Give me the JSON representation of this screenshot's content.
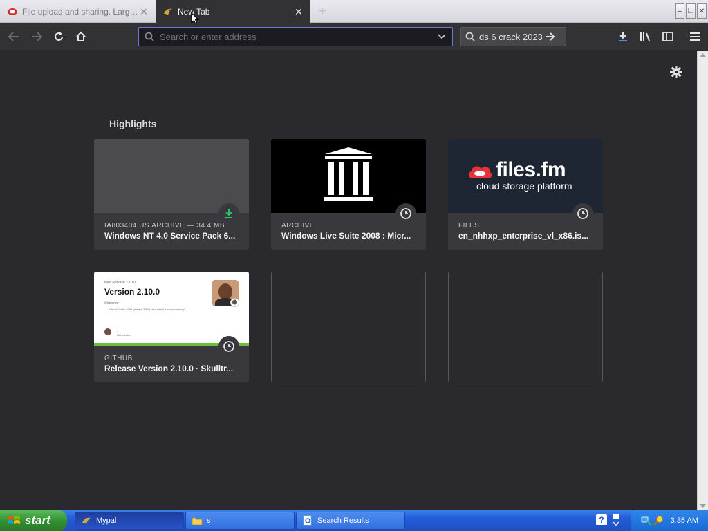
{
  "tabs": [
    {
      "title": "File upload and sharing. Large fil...",
      "active": false
    },
    {
      "title": "New Tab",
      "active": true
    }
  ],
  "navbar": {
    "address_placeholder": "Search or enter address",
    "search_value": "ds 6 crack 2023"
  },
  "main": {
    "section_title": "Highlights",
    "cards": [
      {
        "meta": "IA803404.US.ARCHIVE — 34.4 MB",
        "title": "Windows NT 4.0 Service Pack 6...",
        "badge": "download-icon"
      },
      {
        "meta": "ARCHIVE",
        "title": "Windows Live Suite 2008 : Micr...",
        "badge": "clock-icon"
      },
      {
        "meta": "FILES",
        "title": "en_nhhxp_enterprise_vl_x86.is...",
        "badge": "clock-icon",
        "logo_text": "files.fm",
        "logo_tagline": "cloud storage platform"
      },
      {
        "meta": "GITHUB",
        "title": "Release Version 2.10.0 · Skulltr...",
        "badge": "clock-icon",
        "preview_small": "New Release 2.10.0",
        "preview_heading": "Version 2.10.0",
        "preview_sub": "What's new",
        "preview_bullet": "Visual Studio 2008 (maybe 2005) now install a more correctly...",
        "preview_count": "1",
        "preview_contrib": "Contributor"
      }
    ]
  },
  "taskbar": {
    "start_label": "start",
    "tasks": [
      {
        "label": "Mypal",
        "active": true
      },
      {
        "label": "s",
        "active": false
      },
      {
        "label": "Search Results",
        "active": false
      }
    ],
    "clock": "3:35 AM"
  },
  "colors": {
    "page_bg": "#2a2a2e",
    "card_bg": "#38383d",
    "accent_focus": "#6b78d6",
    "download_green": "#2ac769"
  }
}
